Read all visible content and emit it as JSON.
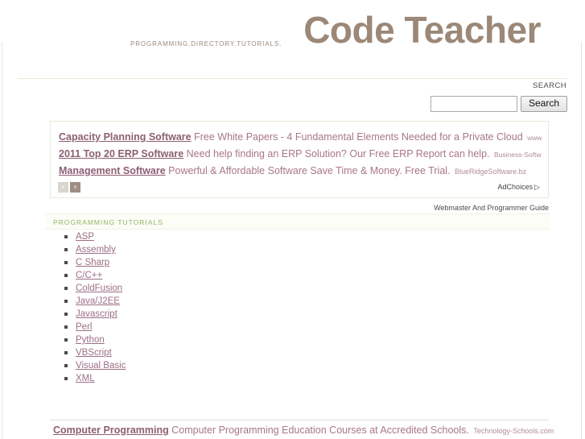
{
  "site": {
    "logo_title": "Code Teacher",
    "tagline": "PROGRAMMING.DIRECTORY.TUTORIALS.",
    "logo_color": "#9b8878"
  },
  "search": {
    "label": "SEARCH",
    "value": "",
    "placeholder": "",
    "button_label": "Search"
  },
  "top_ads": {
    "items": [
      {
        "title": "Capacity Planning Software",
        "description": "Free White Papers - 4 Fundamental Elements Needed for a Private Cloud",
        "url": "www.neta..."
      },
      {
        "title": "2011 Top 20 ERP Software",
        "description": "Need help finding an ERP Solution? Our Free ERP Report can help.",
        "url": "Business-Software.c.."
      },
      {
        "title": "Management Software",
        "description": "Powerful & Affordable Software Save Time & Money. Free Trial.",
        "url": "BlueRidgeSoftware.bz"
      }
    ],
    "prev_label": "‹",
    "next_label": "›",
    "adchoices_label": "AdChoices",
    "adchoices_glyph": "▷",
    "link_color": "#8d5f72"
  },
  "webmaster_note": "Webmaster And Programmer Guide",
  "tutorials": {
    "header": "PROGRAMMING TUTORIALS",
    "header_color": "#8fb563",
    "items": [
      {
        "label": "ASP"
      },
      {
        "label": "Assembly"
      },
      {
        "label": "C Sharp"
      },
      {
        "label": "C/C++"
      },
      {
        "label": "ColdFusion"
      },
      {
        "label": "Java/J2EE"
      },
      {
        "label": "Javascript"
      },
      {
        "label": "Perl"
      },
      {
        "label": "Python"
      },
      {
        "label": "VBScript"
      },
      {
        "label": "Visual Basic"
      },
      {
        "label": "XML"
      }
    ]
  },
  "bottom_ad": {
    "title": "Computer Programming",
    "description": "Computer Programming Education Courses at Accredited Schools.",
    "url": "Technology-Schools.com"
  }
}
